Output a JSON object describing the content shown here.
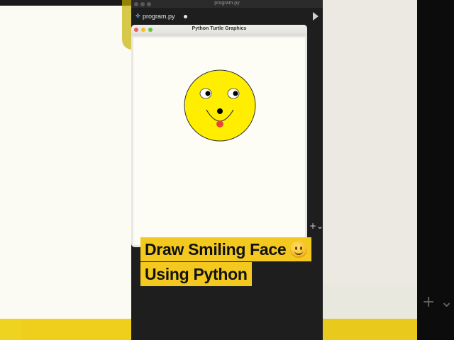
{
  "editor": {
    "window_title": "program.py",
    "tab_label": "program.py"
  },
  "turtle_window": {
    "title": "Python Turtle Graphics"
  },
  "caption": {
    "line1": "Draw Smiling Face",
    "line2": "Using Python"
  },
  "colors": {
    "face": "#ffee00",
    "eye_white": "#ffffff",
    "pupil": "#000000",
    "tongue": "#e8443a",
    "caption_bg": "#f4c91f",
    "canvas_bg": "#fefdf5"
  },
  "icons": {
    "python_file": "python-file-icon",
    "run": "run-icon",
    "emoji": "smiling-face-emoji-icon",
    "plus": "plus-icon"
  }
}
